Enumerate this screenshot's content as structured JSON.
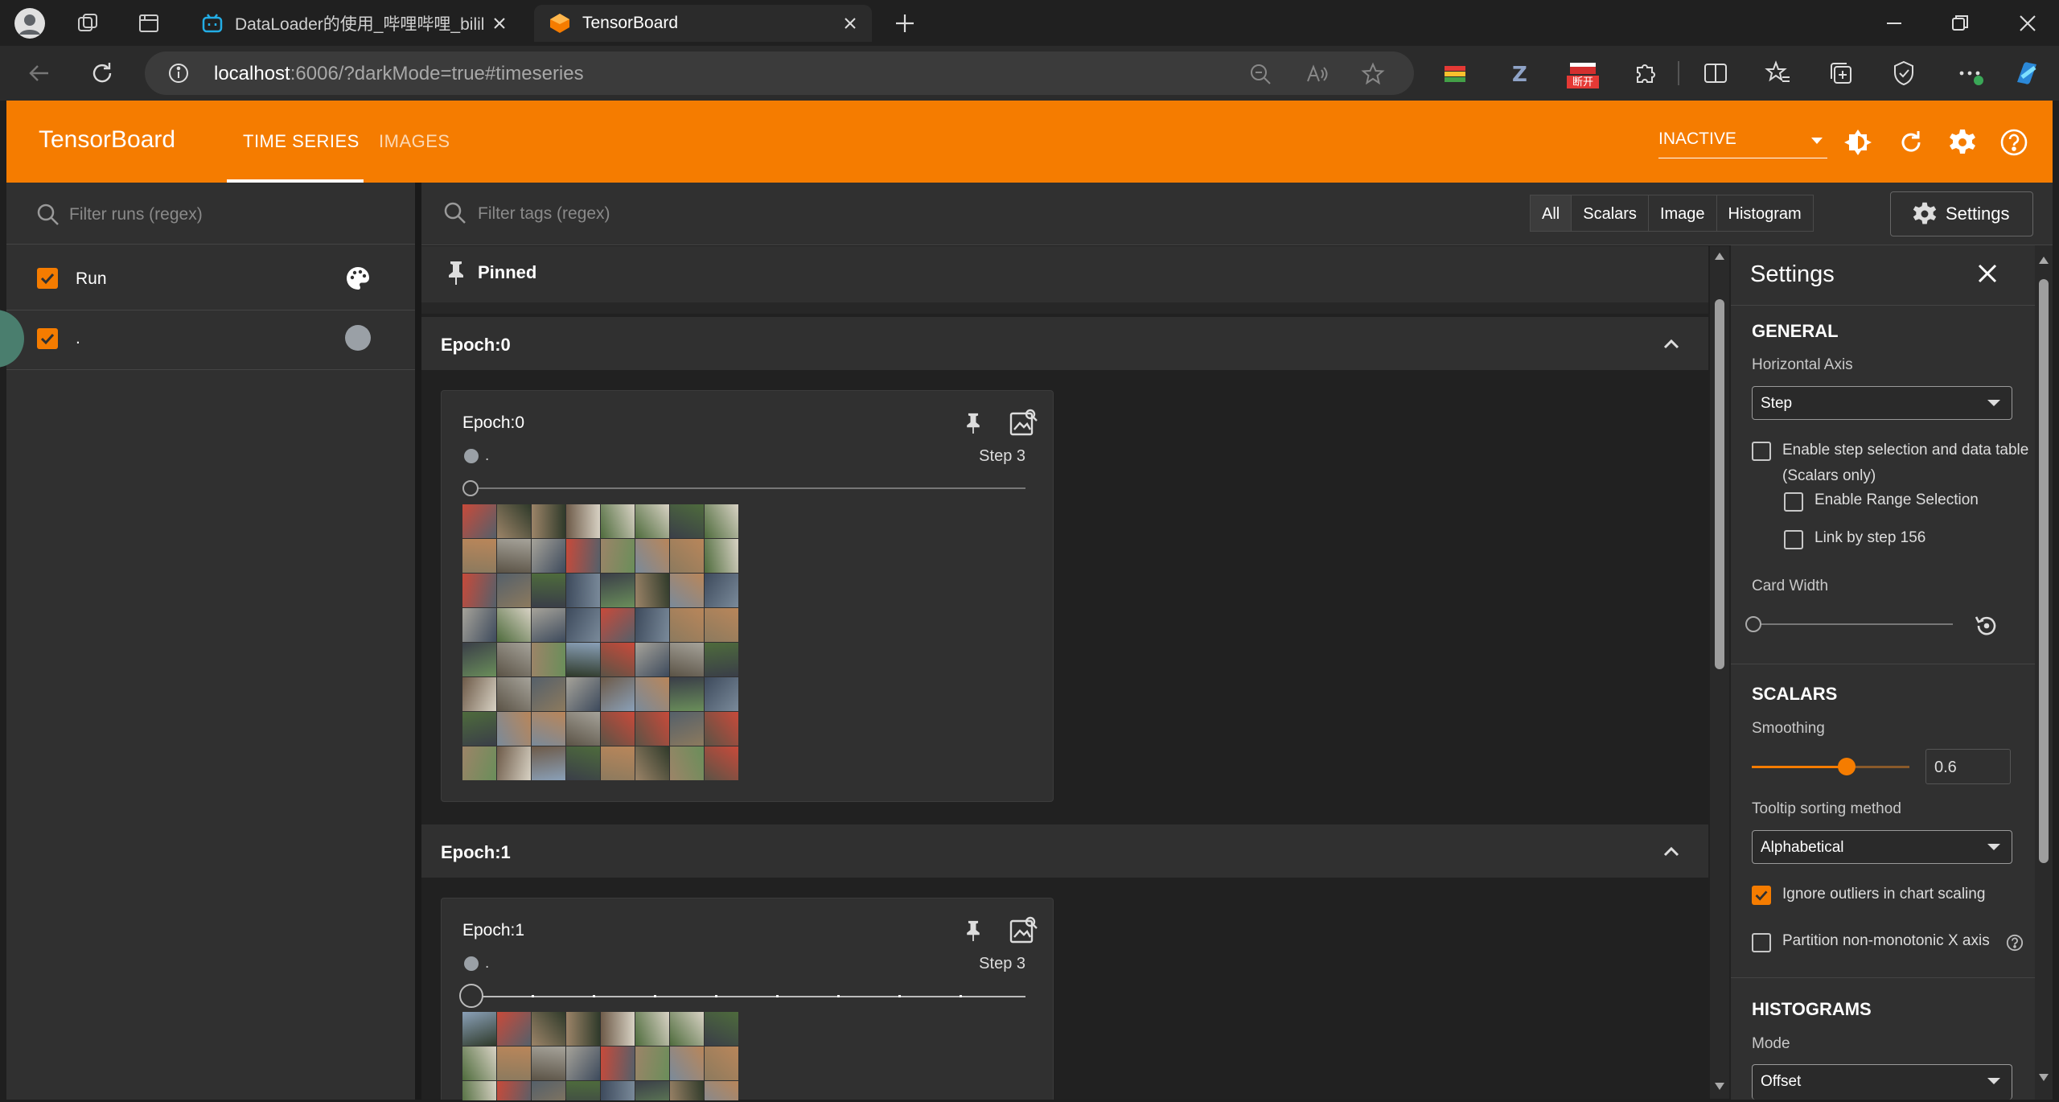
{
  "browser": {
    "tabs": [
      {
        "title": "DataLoader的使用_哔哩哔哩_bilil",
        "active": false,
        "icon": "bilibili-icon"
      },
      {
        "title": "TensorBoard",
        "active": true,
        "icon": "tensorboard-favicon"
      }
    ],
    "address": {
      "host": "localhost",
      "rest": ":6006/?darkMode=true#timeseries"
    },
    "extension_badge": "断开"
  },
  "header": {
    "logo": "TensorBoard",
    "tabs": [
      {
        "label": "TIME SERIES",
        "active": true
      },
      {
        "label": "IMAGES",
        "active": false
      }
    ],
    "status": "INACTIVE",
    "accent": "#f57c00"
  },
  "runs": {
    "filter_placeholder": "Filter runs (regex)",
    "header_label": "Run",
    "items": [
      {
        "name": ".",
        "checked": true,
        "color": "#9aa0a6"
      }
    ]
  },
  "main": {
    "filter_placeholder": "Filter tags (regex)",
    "type_filters": [
      "All",
      "Scalars",
      "Image",
      "Histogram"
    ],
    "settings_button": "Settings",
    "pinned_label": "Pinned",
    "groups": [
      {
        "name": "Epoch:0",
        "card": {
          "title": "Epoch:0",
          "run": ".",
          "step": "Step 3",
          "slider_position": 0.0
        }
      },
      {
        "name": "Epoch:1",
        "card": {
          "title": "Epoch:1",
          "run": ".",
          "step": "Step 3",
          "slider_position": 0.0
        }
      }
    ]
  },
  "settings": {
    "title": "Settings",
    "general": {
      "heading": "GENERAL",
      "horizontal_axis_label": "Horizontal Axis",
      "horizontal_axis_value": "Step",
      "step_selection_label": "Enable step selection and data table",
      "step_selection_sub": "(Scalars only)",
      "range_selection_label": "Enable Range Selection",
      "link_by_step_label": "Link by step 156",
      "card_width_label": "Card Width",
      "card_width_value": 0.0
    },
    "scalars": {
      "heading": "SCALARS",
      "smoothing_label": "Smoothing",
      "smoothing_value": "0.6",
      "smoothing_fraction": 0.6,
      "tooltip_label": "Tooltip sorting method",
      "tooltip_value": "Alphabetical",
      "ignore_outliers_label": "Ignore outliers in chart scaling",
      "ignore_outliers_checked": true,
      "partition_label": "Partition non-monotonic X axis",
      "partition_checked": false
    },
    "histograms": {
      "heading": "HISTOGRAMS",
      "mode_label": "Mode",
      "mode_value": "Offset"
    }
  }
}
